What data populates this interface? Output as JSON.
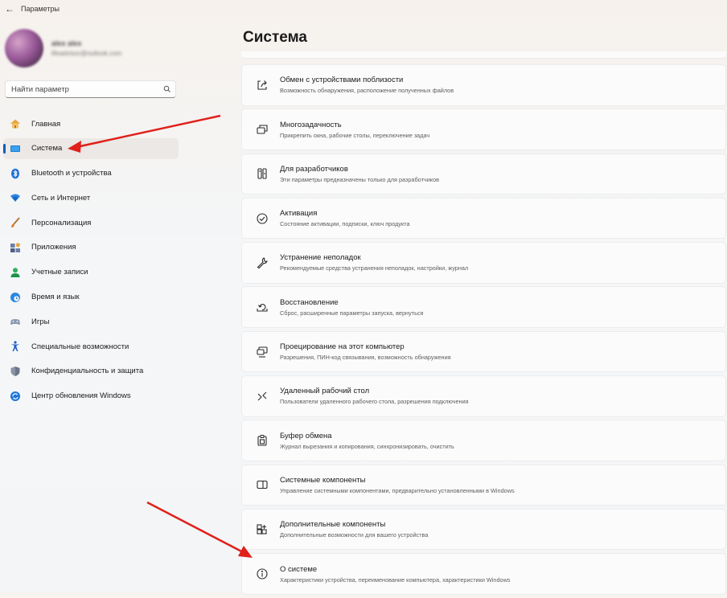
{
  "window": {
    "title": "Параметры",
    "back_icon": "arrow-left-icon"
  },
  "profile": {
    "name": "alex alex",
    "email": "lifeadvisor@outlook.com"
  },
  "search": {
    "placeholder": "Найти параметр",
    "icon": "search-icon"
  },
  "nav": [
    {
      "label": "Главная",
      "icon": "home-icon"
    },
    {
      "label": "Система",
      "icon": "system-icon",
      "active": true
    },
    {
      "label": "Bluetooth и устройства",
      "icon": "bluetooth-icon"
    },
    {
      "label": "Сеть и Интернет",
      "icon": "wifi-icon"
    },
    {
      "label": "Персонализация",
      "icon": "brush-icon"
    },
    {
      "label": "Приложения",
      "icon": "apps-icon"
    },
    {
      "label": "Учетные записи",
      "icon": "account-icon"
    },
    {
      "label": "Время и язык",
      "icon": "globe-clock-icon"
    },
    {
      "label": "Игры",
      "icon": "gamepad-icon"
    },
    {
      "label": "Специальные возможности",
      "icon": "accessibility-icon"
    },
    {
      "label": "Конфиденциальность и защита",
      "icon": "shield-icon"
    },
    {
      "label": "Центр обновления Windows",
      "icon": "update-icon"
    }
  ],
  "main": {
    "title": "Система",
    "cards": [
      {
        "title": "Обмен с устройствами поблизости",
        "subtitle": "Возможность обнаружения, расположение полученных файлов",
        "icon": "share-icon"
      },
      {
        "title": "Многозадачность",
        "subtitle": "Прикрепить окна, рабочие столы, переключение задач",
        "icon": "multitask-icon"
      },
      {
        "title": "Для разработчиков",
        "subtitle": "Эти параметры предназначены только для разработчиков",
        "icon": "developer-icon"
      },
      {
        "title": "Активация",
        "subtitle": "Состояние активации, подписки, ключ продукта",
        "icon": "check-circle-icon"
      },
      {
        "title": "Устранение неполадок",
        "subtitle": "Рекомендуемые средства устранения неполадок, настройки, журнал",
        "icon": "wrench-icon"
      },
      {
        "title": "Восстановление",
        "subtitle": "Сброс, расширенные параметры запуска, вернуться",
        "icon": "recovery-icon"
      },
      {
        "title": "Проецирование на этот компьютер",
        "subtitle": "Разрешения, ПИН-код связывания, возможность обнаружения",
        "icon": "projection-icon"
      },
      {
        "title": "Удаленный рабочий стол",
        "subtitle": "Пользователи удаленного рабочего стола, разрешения подключения",
        "icon": "remote-desktop-icon"
      },
      {
        "title": "Буфер обмена",
        "subtitle": "Журнал вырезания и копирования, синхронизировать, очистить",
        "icon": "clipboard-icon"
      },
      {
        "title": "Системные компоненты",
        "subtitle": "Управление системными компонентами, предварительно установленными в Windows",
        "icon": "components-icon"
      },
      {
        "title": "Дополнительные компоненты",
        "subtitle": "Дополнительные возможности для вашего устройства",
        "icon": "optional-features-icon"
      },
      {
        "title": "О системе",
        "subtitle": "Характеристики устройства, переименование компьютера, характеристики Windows",
        "icon": "info-icon"
      }
    ]
  },
  "colors": {
    "accent": "#005fb8",
    "annotation_arrow": "#e0201b"
  }
}
